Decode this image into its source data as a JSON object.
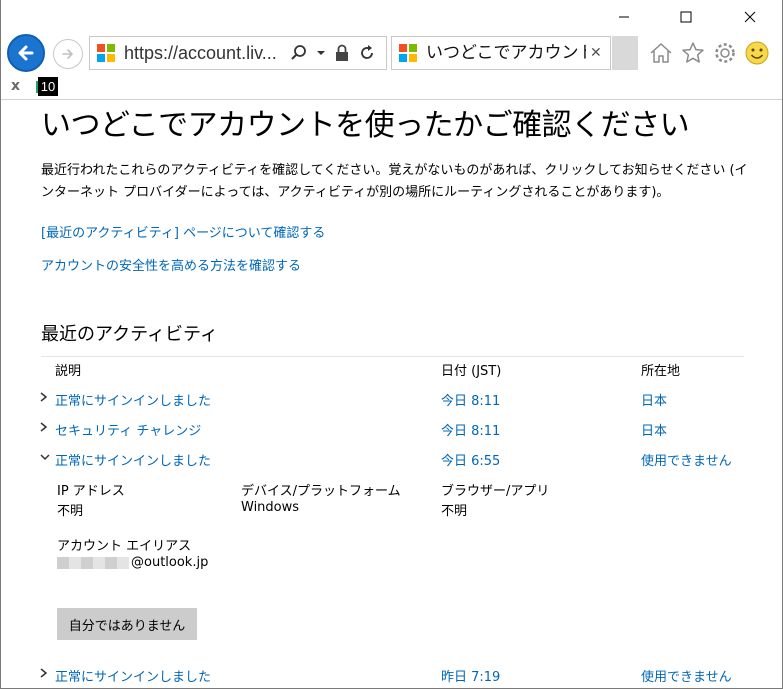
{
  "window": {
    "minimize_icon": "minimize-icon",
    "maximize_icon": "maximize-icon",
    "close_icon": "close-icon"
  },
  "browser": {
    "address_url": "https://account.liv...",
    "tab_title": "いつどこでアカウント...",
    "fav_badge": "10",
    "fav_close": "x"
  },
  "page": {
    "title": "いつどこでアカウントを使ったかご確認ください",
    "intro": "最近行われたこれらのアクティビティを確認してください。覚えがないものがあれば、クリックしてお知らせください (インターネット プロバイダーによっては、アクティビティが別の場所にルーティングされることがあります)。",
    "link1": "[最近のアクティビティ] ページについて確認する",
    "link2": "アカウントの安全性を高める方法を確認する",
    "section_title": "最近のアクティビティ",
    "columns": {
      "description": "説明",
      "date": "日付 (JST)",
      "location": "所在地"
    },
    "activities": [
      {
        "desc": "正常にサインインしました",
        "date": "今日 8:11",
        "location": "日本"
      },
      {
        "desc": "セキュリティ チャレンジ",
        "date": "今日 8:11",
        "location": "日本"
      },
      {
        "desc": "正常にサインインしました",
        "date": "今日 6:55",
        "location": "使用できません"
      },
      {
        "desc": "正常にサインインしました",
        "date": "昨日 7:19",
        "location": "使用できません"
      }
    ],
    "details": {
      "ip_label": "IP アドレス",
      "ip_value": "不明",
      "device_label": "デバイス/プラットフォーム",
      "device_value": "Windows",
      "browser_label": "ブラウザー/アプリ",
      "browser_value": "不明",
      "alias_label": "アカウント エイリアス",
      "alias_value": "@outlook.jp"
    },
    "not_me_button": "自分ではありません"
  },
  "colors": {
    "link": "#0067b8",
    "back_button": "#1b75d0",
    "button_bg": "#cccccc"
  }
}
